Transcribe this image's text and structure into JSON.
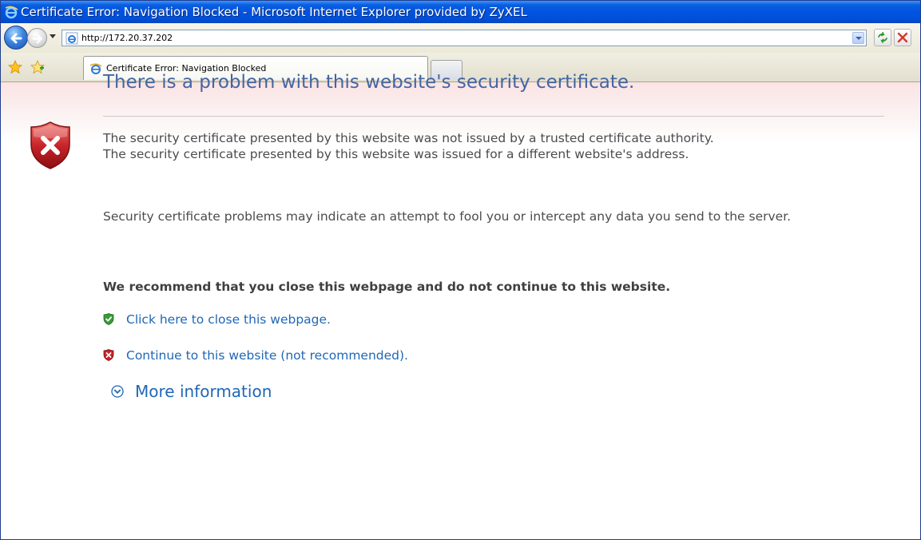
{
  "window": {
    "title": "Certificate Error: Navigation Blocked - Microsoft Internet Explorer provided by ZyXEL"
  },
  "navbar": {
    "address": "http://172.20.37.202"
  },
  "tabs": [
    {
      "label": "Certificate Error: Navigation Blocked"
    }
  ],
  "content": {
    "heading": "There is a problem with this website's security certificate.",
    "paragraph1_line1": "The security certificate presented by this website was not issued by a trusted certificate authority.",
    "paragraph1_line2": "The security certificate presented by this website was issued for a different website's address.",
    "paragraph2": "Security certificate problems may indicate an attempt to fool you or intercept any data you send to the server.",
    "recommendation": "We recommend that you close this webpage and do not continue to this website.",
    "close_link": "Click here to close this webpage.",
    "continue_link": "Continue to this website (not recommended).",
    "more_info": "More information"
  },
  "icons": {
    "title_icon": "ie-logo-icon",
    "back": "back-arrow-icon",
    "forward": "forward-arrow-icon",
    "refresh": "refresh-icon",
    "stop": "stop-icon",
    "favorites": "favorites-star-icon",
    "add_favorite": "add-favorite-icon",
    "error_shield": "red-shield-x-icon",
    "close_shield": "green-shield-check-icon",
    "continue_shield": "red-shield-x-icon",
    "more_info": "expand-circle-icon"
  },
  "colors": {
    "heading": "#4465a2",
    "link": "#1f67b5",
    "titlebar": "#0053e1",
    "error_red": "#c8242a",
    "ok_green": "#3a9a3a"
  }
}
